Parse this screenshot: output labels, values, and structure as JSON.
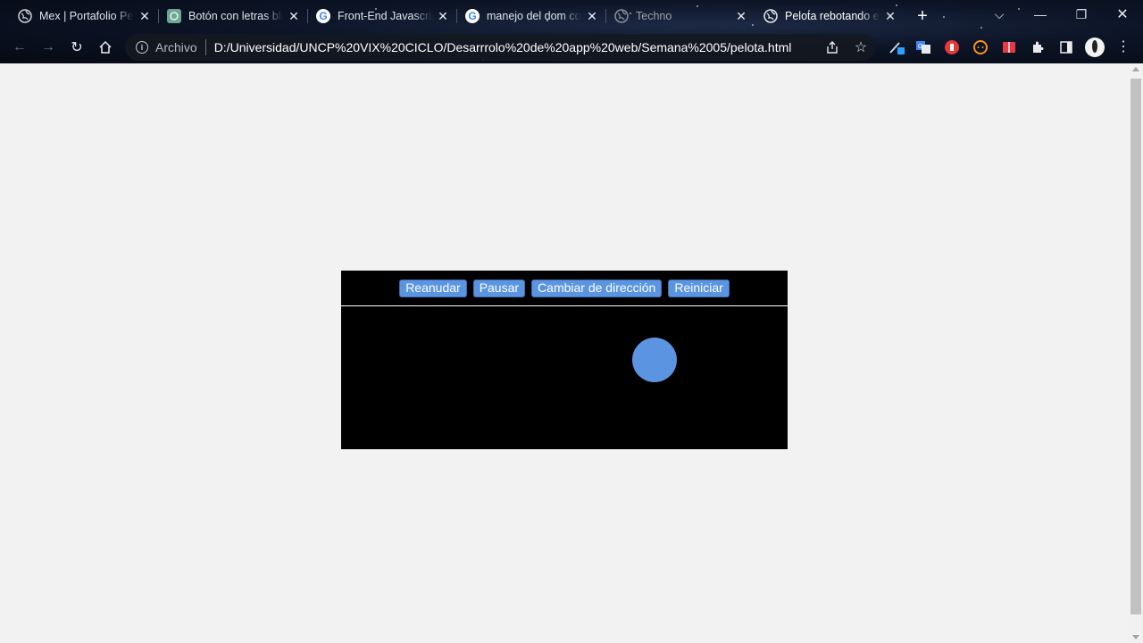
{
  "browser": {
    "tabs": [
      {
        "title": "Mex | Portafolio Per",
        "icon": "globe-icon"
      },
      {
        "title": "Botón con letras bla",
        "icon": "chatgpt-icon"
      },
      {
        "title": "Front-End Javascript",
        "icon": "google-icon"
      },
      {
        "title": "manejo del dom co",
        "icon": "google-icon"
      },
      {
        "title": "Techno",
        "icon": "globe-icon"
      },
      {
        "title": "Pelota rebotando e",
        "icon": "globe-icon",
        "active": true
      }
    ],
    "new_tab_symbol": "+",
    "omnibox": {
      "scheme_label": "Archivo",
      "url": "D:/Universidad/UNCP%20VIX%20CICLO/Desarrrolo%20de%20app%20web/Semana%2005/pelota.html"
    }
  },
  "page": {
    "buttons": {
      "resume": "Reanudar",
      "pause": "Pausar",
      "change_direction": "Cambiar de dirección",
      "restart": "Reiniciar"
    },
    "colors": {
      "background": "#f2f2f2",
      "game_background": "#000000",
      "ball": "#5b95e2",
      "button": "#5b95e2"
    }
  }
}
